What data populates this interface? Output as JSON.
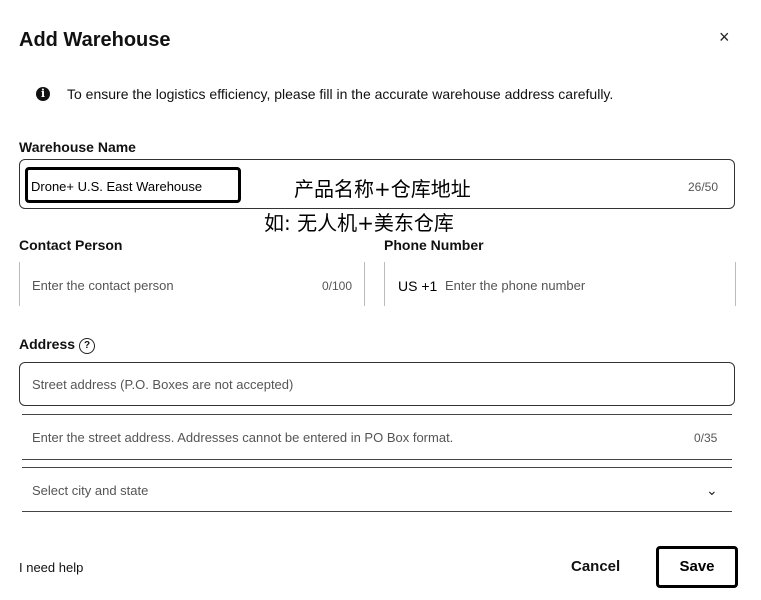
{
  "dialog": {
    "title": "Add Warehouse",
    "close_icon": "×",
    "notice_icon": "i",
    "notice_text": "To ensure the logistics efficiency, please fill in the accurate warehouse address carefully."
  },
  "warehouse_name": {
    "label": "Warehouse Name",
    "value": "Drone+ U.S. East Warehouse",
    "counter": "26/50"
  },
  "overlay": {
    "line1": "产品名称+仓库地址",
    "line2": "如: 无人机+美东仓库"
  },
  "contact_person": {
    "label": "Contact Person",
    "placeholder": "Enter the contact person",
    "counter": "0/100"
  },
  "phone_number": {
    "label": "Phone Number",
    "country_code": "US +1",
    "placeholder": "Enter the phone number"
  },
  "address": {
    "label": "Address",
    "help_icon": "?",
    "street_placeholder": "Street address (P.O. Boxes are not accepted)",
    "street_detail_placeholder": "Enter the street address. Addresses cannot be entered in PO Box format.",
    "street_detail_counter": "0/35",
    "city_state_placeholder": "Select city and state",
    "chevron_icon": "⌄"
  },
  "footer": {
    "help_link": "I need help",
    "cancel_label": "Cancel",
    "save_label": "Save"
  }
}
